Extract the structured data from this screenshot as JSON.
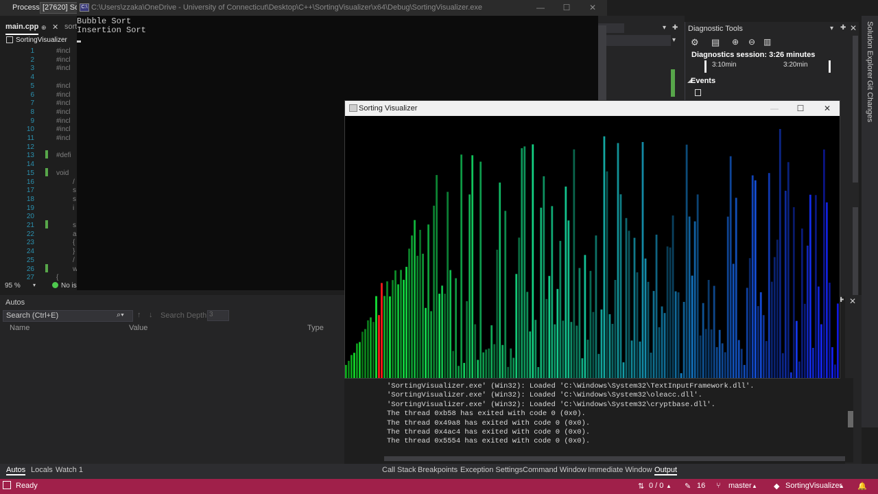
{
  "process_bar": {
    "label": "Process:",
    "value": "[27620] Sor"
  },
  "console": {
    "title": "C:\\Users\\zzaka\\OneDrive - University of Connecticut\\Desktop\\C++\\SortingVisualizer\\x64\\Debug\\SortingVisualizer.exe",
    "lines": [
      "Bubble Sort",
      "Insertion Sort"
    ]
  },
  "editor": {
    "tabs": [
      "main.cpp",
      "sort"
    ],
    "nav": "SortingVisualizer",
    "line_numbers": [
      "1",
      "2",
      "3",
      "4",
      "5",
      "6",
      "7",
      "8",
      "9",
      "10",
      "11",
      "12",
      "13",
      "14",
      "15",
      "16",
      "17",
      "18",
      "19",
      "20",
      "21",
      "22",
      "23",
      "24",
      "25",
      "26",
      "27"
    ],
    "code": [
      "#incl",
      "#incl",
      "#incl",
      "",
      "#incl",
      "#incl",
      "#incl",
      "#incl",
      "#incl",
      "#incl",
      "#incl",
      "",
      "#defi",
      "",
      "void",
      "/",
      "s",
      "s",
      "i",
      "",
      "s",
      "a",
      "{",
      "}",
      "/",
      "w",
      "{"
    ],
    "zoom": "95 %",
    "issues": "No is"
  },
  "diagnostics": {
    "title": "Diagnostic Tools",
    "session": "Diagnostics session: 3:26 minutes",
    "tick1": "3:10min",
    "tick2": "3:20min",
    "events": "Events"
  },
  "side_tabs": [
    "Solution Explorer",
    "Git Changes"
  ],
  "autos": {
    "title": "Autos",
    "search_placeholder": "Search (Ctrl+E)",
    "search_depth": "Search Depth:",
    "depth_value": "3",
    "columns": [
      "Name",
      "Value",
      "Type"
    ]
  },
  "output": {
    "lines": [
      "'SortingVisualizer.exe' (Win32): Loaded 'C:\\Windows\\System32\\TextInputFramework.dll'.",
      "'SortingVisualizer.exe' (Win32): Loaded 'C:\\Windows\\System32\\oleacc.dll'.",
      "'SortingVisualizer.exe' (Win32): Loaded 'C:\\Windows\\System32\\cryptbase.dll'.",
      "The thread 0xb58 has exited with code 0 (0x0).",
      "The thread 0x49a8 has exited with code 0 (0x0).",
      "The thread 0x4ac4 has exited with code 0 (0x0).",
      "The thread 0x5554 has exited with code 0 (0x0)."
    ]
  },
  "bottom_tabs_left": [
    "Autos",
    "Locals",
    "Watch 1"
  ],
  "bottom_tabs_right": [
    "Call Stack",
    "Breakpoints",
    "Exception Settings",
    "Command Window",
    "Immediate Window",
    "Output"
  ],
  "status": {
    "ready": "Ready",
    "errors": "0 / 0",
    "edits": "16",
    "branch": "master",
    "repo": "SortingVisualizer"
  },
  "visualizer": {
    "title": "Sorting Visualizer",
    "highlight_color": "#ff1a1a",
    "bar_count": 180,
    "seed": 7
  },
  "colors": {
    "status_bar": "#a0204a",
    "console_bg": "#0c0c0c",
    "editor_bg": "#1e1e1e"
  }
}
